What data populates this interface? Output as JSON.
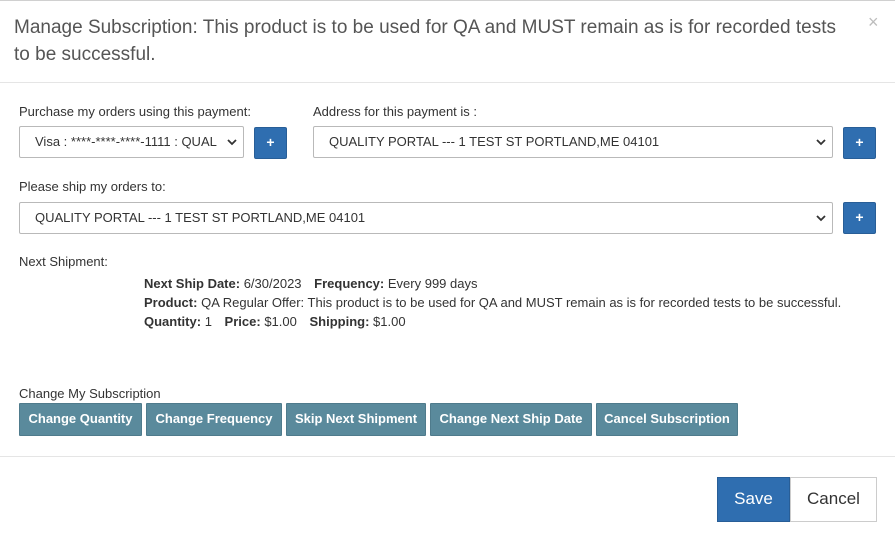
{
  "modal": {
    "title": "Manage Subscription: This product is to be used for QA and MUST remain as is for recorded tests to be successful.",
    "close_glyph": "×"
  },
  "payment": {
    "label": "Purchase my orders using this payment:",
    "selected": "Visa : ****-****-****-1111 : QUAL",
    "add_label": "+"
  },
  "billing_address": {
    "label": "Address for this payment is :",
    "selected": "QUALITY PORTAL --- 1 TEST ST PORTLAND,ME 04101",
    "add_label": "+"
  },
  "shipping_address": {
    "label": "Please ship my orders to:",
    "selected": "QUALITY PORTAL --- 1 TEST ST PORTLAND,ME 04101",
    "add_label": "+"
  },
  "next_shipment": {
    "label": "Next Shipment:",
    "ship_date_label": "Next Ship Date:",
    "ship_date": "6/30/2023",
    "frequency_label": "Frequency:",
    "frequency": "Every 999 days",
    "product_label": "Product:",
    "product": "QA Regular Offer: This product is to be used for QA and MUST remain as is for recorded tests to be successful.",
    "quantity_label": "Quantity:",
    "quantity": "1",
    "price_label": "Price:",
    "price": "$1.00",
    "shipping_label": "Shipping:",
    "shipping": "$1.00"
  },
  "change": {
    "label": "Change My Subscription",
    "buttons": [
      "Change Quantity",
      "Change Frequency",
      "Skip Next Shipment",
      "Change Next Ship Date",
      "Cancel Subscription"
    ]
  },
  "footer": {
    "save_label": "Save",
    "cancel_label": "Cancel"
  },
  "colors": {
    "primary_button": "#2f6eb0",
    "action_button": "#5a8a9c"
  }
}
